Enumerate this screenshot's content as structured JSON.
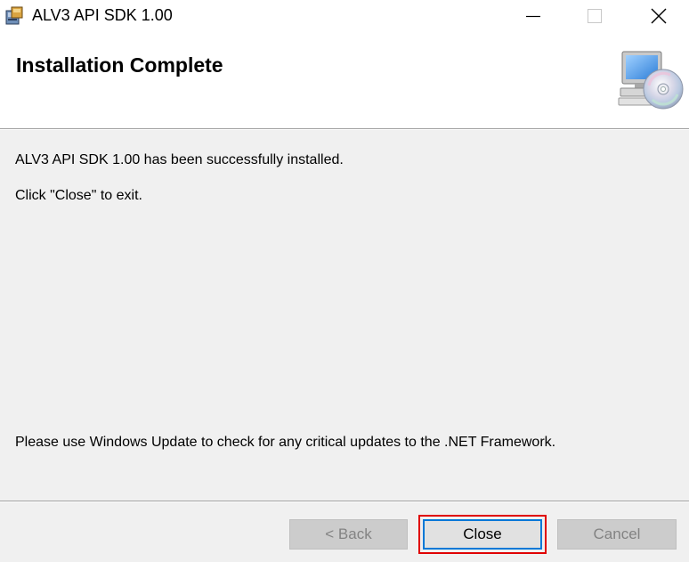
{
  "window": {
    "title": "ALV3 API SDK 1.00",
    "controls": {
      "minimize": "minimize",
      "maximize": "maximize",
      "close": "close"
    }
  },
  "banner": {
    "title": "Installation Complete",
    "graphic": "computer-cd-icon"
  },
  "body": {
    "message_installed": "ALV3 API SDK 1.00 has been successfully installed.",
    "message_exit": "Click \"Close\" to exit.",
    "message_update": "Please use Windows Update to check for any critical updates to the .NET Framework."
  },
  "buttons": {
    "back": "< Back",
    "close": "Close",
    "cancel": "Cancel"
  },
  "colors": {
    "focus_border": "#0078d7",
    "highlight": "#e00000",
    "disabled_text": "#838383"
  }
}
